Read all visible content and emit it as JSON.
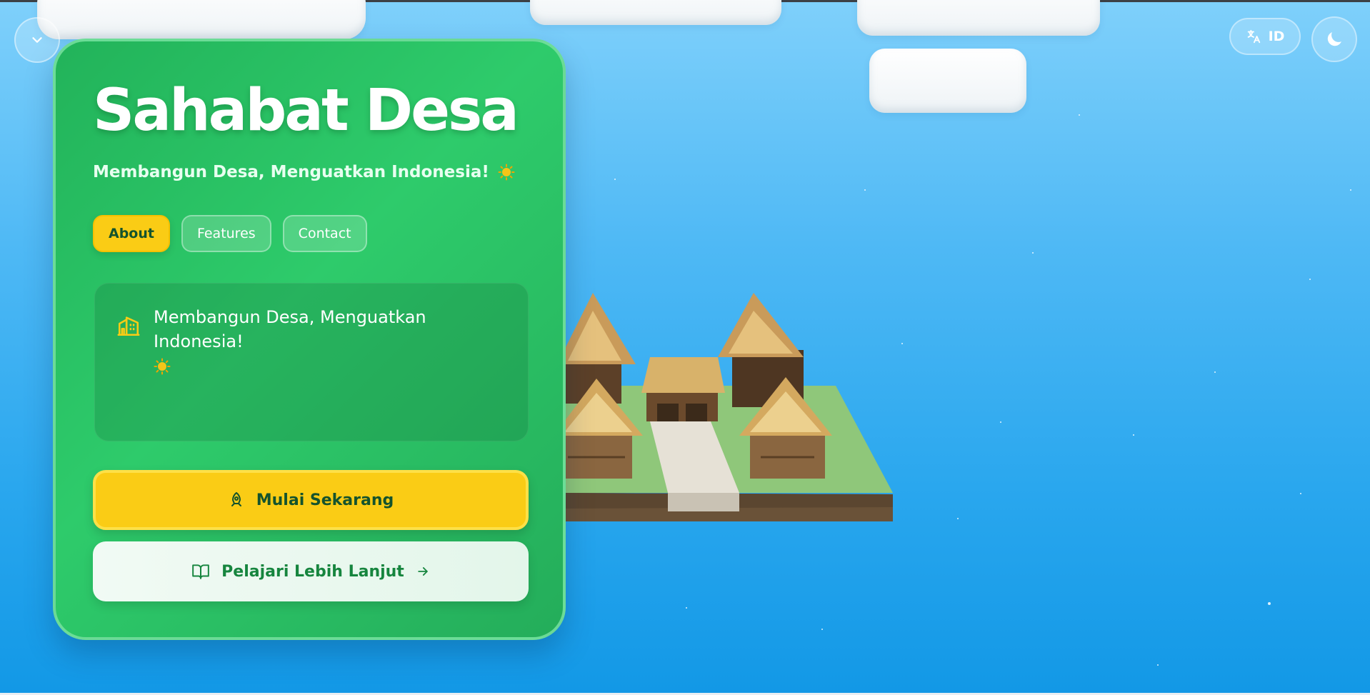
{
  "hero": {
    "title": "Sahabat Desa",
    "subtitle": "Membangun Desa, Menguatkan Indonesia!",
    "subtitle_icon": "sun-emoji-icon"
  },
  "tabs": [
    {
      "label": "About",
      "active": true
    },
    {
      "label": "Features",
      "active": false
    },
    {
      "label": "Contact",
      "active": false
    }
  ],
  "about_panel": {
    "icon": "building-icon",
    "text": "Membangun Desa, Menguatkan Indonesia!",
    "text_icon": "sun-emoji-icon"
  },
  "actions": {
    "primary_label": "Mulai Sekarang",
    "primary_icon": "rocket-icon",
    "secondary_label": "Pelajari Lebih Lanjut",
    "secondary_icon": "book-open-icon",
    "secondary_trailing_icon": "arrow-right-icon"
  },
  "top_controls": {
    "collapse_icon": "chevron-down-icon",
    "language_label": "ID",
    "language_icon": "translate-icon",
    "theme_icon": "moon-icon"
  },
  "colors": {
    "card_green": "#2ecb6b",
    "accent_yellow": "#facc15",
    "text_dark_green": "#14532d",
    "sky_blue": "#4fb9f5"
  }
}
